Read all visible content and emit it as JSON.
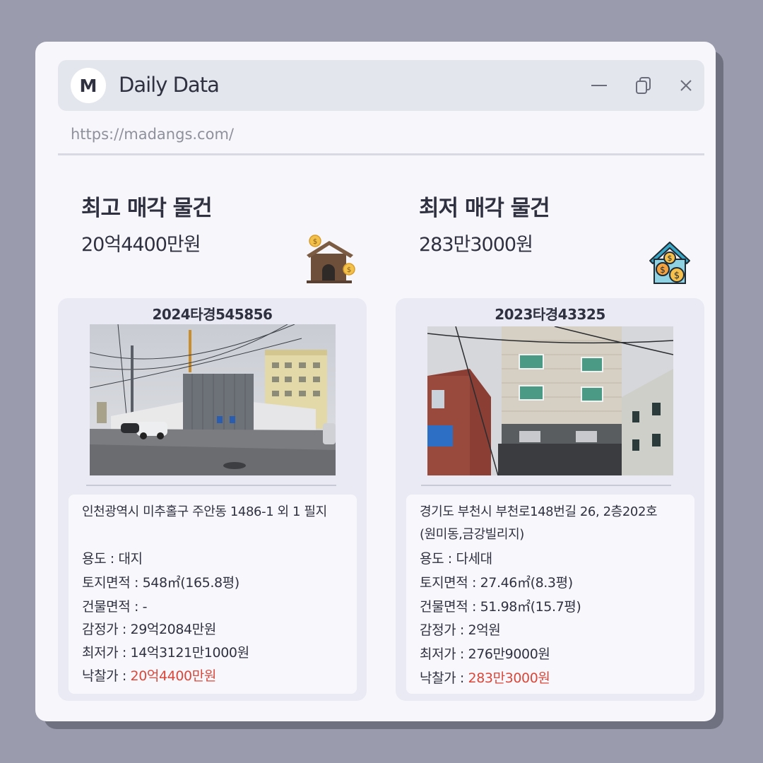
{
  "app": {
    "logo_letter": "M",
    "title": "Daily Data",
    "url": "https://madangs.com/"
  },
  "highest": {
    "title": "최고 매각 물건",
    "price": "20억4400만원",
    "case_no": "2024타경545856",
    "address": "인천광역시 미추홀구 주안동 1486-1 외 1 필지",
    "usage": "용도 : 대지",
    "land_area": "토지면적 : 548㎡(165.8평)",
    "building_area": "건물면적 : -",
    "appraisal": "감정가 : 29억2084만원",
    "min_price": "최저가 : 14억3121만1000원",
    "sold_label": "낙찰가 : ",
    "sold_price": "20억4400만원"
  },
  "lowest": {
    "title": "최저 매각 물건",
    "price": "283만3000원",
    "case_no": "2023타경43325",
    "address_line1": "경기도 부천시 부천로148번길 26, 2층202호",
    "address_line2": "(원미동,금강빌리지)",
    "usage": "용도 : 다세대",
    "land_area": "토지면적 : 27.46㎡(8.3평)",
    "building_area": "건물면적 : 51.98㎡(15.7평)",
    "appraisal": "감정가 : 2억원",
    "min_price": "최저가 : 276만9000원",
    "sold_label": "낙찰가 : ",
    "sold_price": "283만3000원"
  },
  "icons": {
    "minimize": "minimize-icon",
    "restore": "restore-icon",
    "close": "close-icon",
    "house_money_left": "house-with-coins-icon",
    "house_money_right": "house-money-icon"
  },
  "colors": {
    "background": "#9a9cad",
    "window": "#f7f7fb",
    "titlebar": "#e4e6ee",
    "card": "#e9eaf3",
    "sold_price": "#d9483b"
  }
}
